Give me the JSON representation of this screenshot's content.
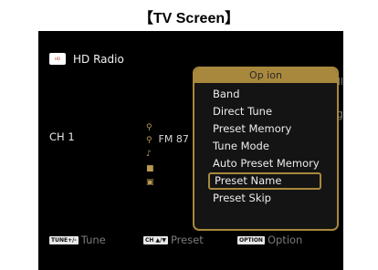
{
  "heading": "【TV Screen】",
  "source": {
    "icon": "hd-radio-logo-icon",
    "label": "HD Radio"
  },
  "channel_label": "CH 1",
  "station": "FM 87",
  "right_fragments": {
    "signal": "ill",
    "text": "ng"
  },
  "hints": {
    "tune_key": "TUNE+/-",
    "tune": "Tune",
    "preset_key": "CH ▲/▼",
    "preset": "Preset",
    "option_key": "OPTION",
    "option": "Option"
  },
  "menu": {
    "title": "Op ion",
    "items": [
      "Band",
      "Direct Tune",
      "Preset Memory",
      "Tune Mode",
      "Auto Preset Memory",
      "Preset Name",
      "Preset Skip"
    ],
    "selected_index": 5
  },
  "colors": {
    "accent": "#a8883c",
    "screen_bg": "#000000",
    "text": "#dcdcdc",
    "hint": "#7a7a7a"
  }
}
